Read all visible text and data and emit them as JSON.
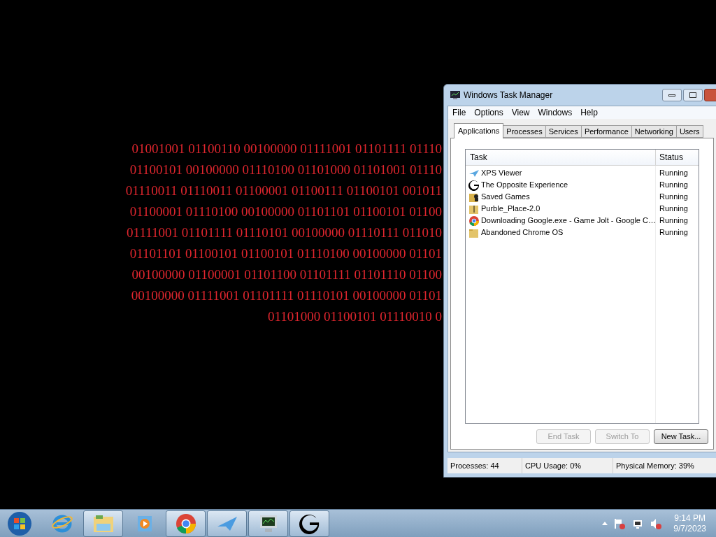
{
  "desktop": {
    "binary_lines": [
      "01001001 01100110 00100000 01111001 01101111 01110",
      "01100101 00100000 01110100 01101000 01101001 01110",
      "01110011 01110011 01100001 01100111 01100101 001011",
      "01100001 01110100 00100000 01101101 01100101 01100",
      "01111001 01101111 01110101 00100000 01110111 011010",
      "01101101 01100101 01100101 01110100 00100000 01101",
      "00100000 01100001 01101100 01101111 01101110 01100",
      "00100000 01111001 01101111 01110101 00100000 01101",
      "01101000 01100101 01110010 0"
    ]
  },
  "window": {
    "title": "Windows Task Manager",
    "menu": [
      "File",
      "Options",
      "View",
      "Windows",
      "Help"
    ],
    "tabs": [
      {
        "label": "Applications",
        "selected": true
      },
      {
        "label": "Processes",
        "selected": false
      },
      {
        "label": "Services",
        "selected": false
      },
      {
        "label": "Performance",
        "selected": false
      },
      {
        "label": "Networking",
        "selected": false
      },
      {
        "label": "Users",
        "selected": false
      }
    ],
    "columns": [
      "Task",
      "Status"
    ],
    "rows": [
      {
        "task": "XPS Viewer",
        "status": "Running",
        "kind": "plane"
      },
      {
        "task": "The Opposite Experience",
        "status": "Running",
        "kind": "letter"
      },
      {
        "task": "Saved Games",
        "status": "Running",
        "kind": "folder-chess"
      },
      {
        "task": "Purble_Place-2.0",
        "status": "Running",
        "kind": "zip"
      },
      {
        "task": "Downloading Google.exe - Game Jolt - Google C…",
        "status": "Running",
        "kind": "chrome"
      },
      {
        "task": "Abandoned Chrome OS",
        "status": "Running",
        "kind": "folder"
      }
    ],
    "buttons": [
      {
        "label": "End Task",
        "disabled": true
      },
      {
        "label": "Switch To",
        "disabled": true
      },
      {
        "label": "New Task...",
        "disabled": false
      }
    ],
    "status_bar": [
      "Processes: 44",
      "CPU Usage: 0%",
      "Physical Memory: 39%"
    ]
  },
  "taskbar": {
    "items": [
      {
        "kind": "ie",
        "running": false
      },
      {
        "kind": "explorer",
        "running": true
      },
      {
        "kind": "media",
        "running": false
      },
      {
        "kind": "chrome",
        "running": true
      },
      {
        "kind": "plane",
        "running": true
      },
      {
        "kind": "monitor",
        "running": true
      },
      {
        "kind": "letter",
        "running": true
      }
    ],
    "time": "9:14 PM",
    "date": "9/7/2023"
  }
}
